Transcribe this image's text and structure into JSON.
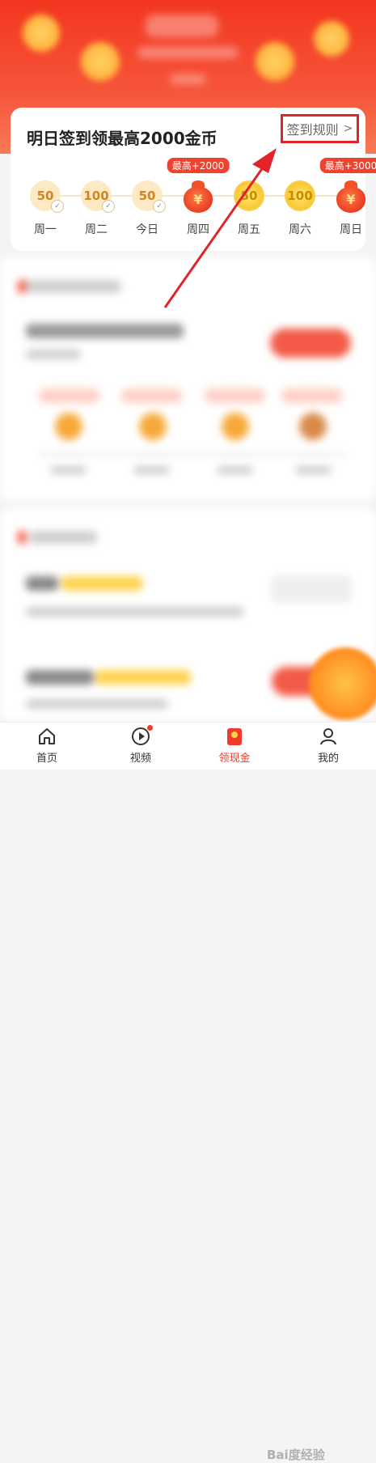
{
  "checkin": {
    "title": "明日签到领最高2000金币",
    "rules_label": "签到规则",
    "rules_chevron": ">",
    "days": [
      {
        "label": "周一",
        "type": "coin",
        "value": "50",
        "signed": true
      },
      {
        "label": "周二",
        "type": "coin",
        "value": "100",
        "signed": true
      },
      {
        "label": "今日",
        "type": "coin",
        "value": "50",
        "signed": true
      },
      {
        "label": "周四",
        "type": "bag",
        "symbol": "¥",
        "badge": "最高+2000"
      },
      {
        "label": "周五",
        "type": "gold",
        "value": "50"
      },
      {
        "label": "周六",
        "type": "gold",
        "value": "100"
      },
      {
        "label": "周日",
        "type": "bag",
        "symbol": "¥",
        "badge": "最高+3000"
      }
    ]
  },
  "tabs": [
    {
      "label": "首页",
      "icon": "home-icon"
    },
    {
      "label": "视频",
      "icon": "play-icon",
      "dot": true
    },
    {
      "label": "领现金",
      "icon": "red-envelope-icon",
      "active": true
    },
    {
      "label": "我的",
      "icon": "profile-icon"
    }
  ],
  "watermark": "Bai度经验",
  "colors": {
    "accent": "#f03b2a",
    "annotation": "#e2232a",
    "coin_gold": "#f8c52e"
  }
}
